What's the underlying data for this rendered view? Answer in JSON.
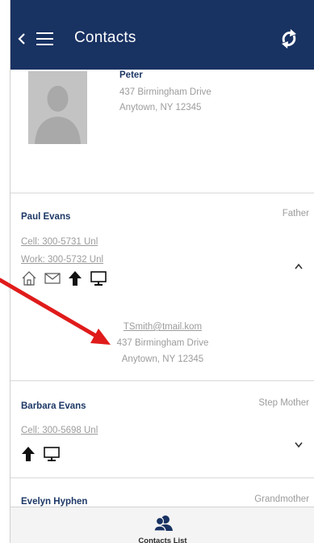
{
  "header": {
    "title": "Contacts",
    "background": "#183262"
  },
  "profile": {
    "name": "Peter",
    "address_line1": "437 Birmingham Drive",
    "address_line2": "Anytown, NY 12345"
  },
  "contacts": [
    {
      "name": "Paul Evans",
      "relation": "Father",
      "phones": [
        "Cell: 300-5731 Unl",
        "Work: 300-5732 Unl"
      ],
      "icons": [
        "home-icon",
        "mail-icon",
        "upload-arrow-icon",
        "monitor-icon"
      ],
      "expanded": true,
      "details": {
        "email": "TSmith@tmail.kom",
        "address_line1": "437 Birmingham Drive",
        "address_line2": "Anytown, NY 12345"
      }
    },
    {
      "name": "Barbara Evans",
      "relation": "Step Mother",
      "phones": [
        "Cell: 300-5698 Unl"
      ],
      "icons": [
        "upload-arrow-icon",
        "monitor-icon"
      ],
      "expanded": false
    },
    {
      "name": "Evelyn Hyphen",
      "relation": "Grandmother"
    }
  ],
  "footer": {
    "label": "Contacts List",
    "icon": "contacts-group-icon"
  },
  "colors": {
    "name_text": "#1d3866",
    "secondary_text": "#9c9c9c",
    "annotation_arrow": "#e01b1b"
  }
}
